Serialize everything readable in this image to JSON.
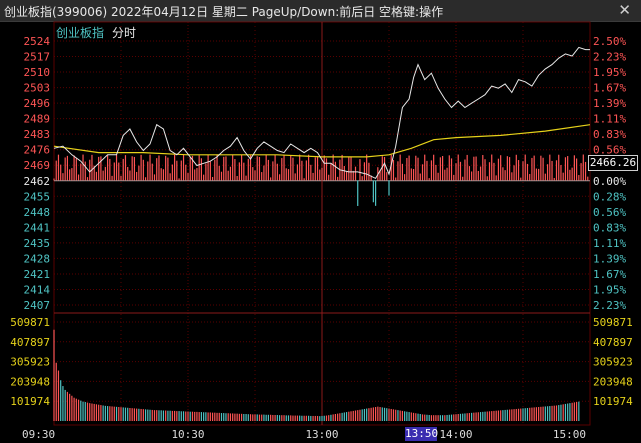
{
  "window": {
    "title": "创业板指(399006) 2022年04月12日 星期二 PageUp/Down:前后日 空格键:操作",
    "close_label": "✕"
  },
  "header": {
    "index_name": "创业板指",
    "mode_label": "分时"
  },
  "colors": {
    "up": "#ff5555",
    "down": "#4fc3c3",
    "grid": "#5a0000",
    "price_line": "#e8e8e8",
    "avg_line": "#e6d21a",
    "volume_axis": "#e6d21a",
    "prevclose": "#cfcfcf"
  },
  "current_price_label": "2466.26",
  "highlight_time": "13:50",
  "chart_data": {
    "type": "line",
    "title": "",
    "prev_close": 2462,
    "price_ticks": [
      "2524",
      "2517",
      "2510",
      "2503",
      "2496",
      "2489",
      "2483",
      "2476",
      "2469",
      "2462",
      "2455",
      "2448",
      "2441",
      "2435",
      "2428",
      "2421",
      "2414",
      "2407"
    ],
    "pct_ticks": [
      "2.50%",
      "2.23%",
      "1.95%",
      "1.67%",
      "1.39%",
      "1.11%",
      "0.83%",
      "0.56%",
      "0.28%",
      "0.00%",
      "0.28%",
      "0.56%",
      "0.83%",
      "1.11%",
      "1.39%",
      "1.67%",
      "1.95%",
      "2.23%"
    ],
    "volume_ticks": [
      "509871",
      "407897",
      "305923",
      "203948",
      "101974"
    ],
    "time_ticks": [
      "09:30",
      "10:30",
      "13:00",
      "14:00",
      "15:00"
    ],
    "ylim": [
      2404,
      2527
    ],
    "volume_max": 509871,
    "price_series": {
      "name": "",
      "points": [
        [
          0,
          2477
        ],
        [
          4,
          2478
        ],
        [
          8,
          2474
        ],
        [
          12,
          2471
        ],
        [
          16,
          2466
        ],
        [
          20,
          2470
        ],
        [
          24,
          2474
        ],
        [
          28,
          2474
        ],
        [
          31,
          2483
        ],
        [
          34,
          2486
        ],
        [
          37,
          2480
        ],
        [
          40,
          2476
        ],
        [
          43,
          2479
        ],
        [
          46,
          2488
        ],
        [
          49,
          2486
        ],
        [
          52,
          2476
        ],
        [
          55,
          2474
        ],
        [
          58,
          2477
        ],
        [
          61,
          2473
        ],
        [
          64,
          2469
        ],
        [
          67,
          2470
        ],
        [
          70,
          2471
        ],
        [
          73,
          2473
        ],
        [
          76,
          2476
        ],
        [
          79,
          2478
        ],
        [
          82,
          2482
        ],
        [
          85,
          2476
        ],
        [
          88,
          2472
        ],
        [
          91,
          2477
        ],
        [
          94,
          2480
        ],
        [
          97,
          2478
        ],
        [
          100,
          2476
        ],
        [
          103,
          2475
        ],
        [
          106,
          2479
        ],
        [
          109,
          2477
        ],
        [
          112,
          2475
        ],
        [
          115,
          2477
        ],
        [
          118,
          2475
        ],
        [
          121,
          2470
        ],
        [
          124,
          2470
        ],
        [
          128,
          2467
        ],
        [
          132,
          2466
        ],
        [
          136,
          2466
        ],
        [
          140,
          2465
        ],
        [
          144,
          2463
        ],
        [
          148,
          2470
        ],
        [
          150,
          2465
        ],
        [
          153,
          2478
        ],
        [
          156,
          2496
        ],
        [
          159,
          2500
        ],
        [
          161,
          2510
        ],
        [
          163,
          2516
        ],
        [
          166,
          2509
        ],
        [
          169,
          2512
        ],
        [
          172,
          2505
        ],
        [
          175,
          2500
        ],
        [
          178,
          2496
        ],
        [
          181,
          2499
        ],
        [
          184,
          2496
        ],
        [
          187,
          2498
        ],
        [
          190,
          2500
        ],
        [
          193,
          2502
        ],
        [
          196,
          2506
        ],
        [
          199,
          2505
        ],
        [
          202,
          2507
        ],
        [
          205,
          2503
        ],
        [
          208,
          2509
        ],
        [
          211,
          2508
        ],
        [
          214,
          2506
        ],
        [
          217,
          2511
        ],
        [
          220,
          2514
        ],
        [
          223,
          2516
        ],
        [
          226,
          2519
        ],
        [
          229,
          2521
        ],
        [
          232,
          2520
        ],
        [
          235,
          2524
        ],
        [
          238,
          2523
        ],
        [
          240,
          2523
        ]
      ]
    },
    "avg_series": {
      "name": "",
      "points": [
        [
          0,
          2478
        ],
        [
          20,
          2475
        ],
        [
          40,
          2475
        ],
        [
          60,
          2474
        ],
        [
          80,
          2474
        ],
        [
          100,
          2474
        ],
        [
          120,
          2473
        ],
        [
          140,
          2473
        ],
        [
          150,
          2474
        ],
        [
          160,
          2477
        ],
        [
          170,
          2481
        ],
        [
          180,
          2482
        ],
        [
          200,
          2483
        ],
        [
          220,
          2485
        ],
        [
          240,
          2488
        ]
      ]
    },
    "bars": {
      "count": 240,
      "amplitude_up": 4.5,
      "amplitude_down": 4.5
    },
    "volume": {
      "values": [
        470000,
        300000,
        260000,
        210000,
        180000,
        160000,
        150000,
        140000,
        130000,
        120000,
        115000,
        110000,
        105000,
        100000,
        98000,
        95000,
        92000,
        90000,
        88000,
        86000,
        84000,
        82000,
        80000,
        78000,
        77000,
        76000,
        75000,
        74000,
        73000,
        72000,
        71000,
        70000,
        69000,
        68000,
        67000,
        66000,
        65000,
        64000,
        63000,
        62000,
        61000,
        60000,
        59000,
        58000,
        57000,
        56000,
        56000,
        55000,
        55000,
        54000,
        54000,
        53000,
        53000,
        52000,
        52000,
        51000,
        51000,
        50000,
        50000,
        49000,
        49000,
        48000,
        48000,
        47000,
        47000,
        46000,
        46000,
        45000,
        45000,
        44000,
        44000,
        43000,
        43000,
        42000,
        42000,
        41000,
        41000,
        40000,
        40000,
        39000,
        39000,
        38000,
        38000,
        37000,
        37000,
        36000,
        36000,
        35000,
        35000,
        34000,
        34000,
        34000,
        33000,
        33000,
        33000,
        32000,
        32000,
        32000,
        31000,
        31000,
        31000,
        30000,
        30000,
        30000,
        29000,
        29000,
        29000,
        28000,
        28000,
        28000,
        28000,
        27000,
        27000,
        27000,
        27000,
        26000,
        26000,
        26000,
        26000,
        25000,
        26000,
        27000,
        28000,
        30000,
        32000,
        34000,
        36000,
        38000,
        40000,
        42000,
        44000,
        46000,
        48000,
        50000,
        52000,
        54000,
        56000,
        58000,
        60000,
        62000,
        64000,
        66000,
        68000,
        70000,
        72000,
        74000,
        72000,
        70000,
        68000,
        66000,
        64000,
        62000,
        60000,
        58000,
        56000,
        54000,
        52000,
        50000,
        48000,
        46000,
        44000,
        42000,
        40000,
        38000,
        36000,
        34000,
        33000,
        32000,
        31000,
        30000,
        30000,
        30000,
        30000,
        30000,
        30000,
        30000,
        31000,
        32000,
        33000,
        34000,
        35000,
        36000,
        37000,
        38000,
        39000,
        40000,
        41000,
        42000,
        43000,
        44000,
        45000,
        46000,
        47000,
        48000,
        49000,
        50000,
        51000,
        52000,
        53000,
        54000,
        55000,
        56000,
        57000,
        58000,
        59000,
        60000,
        61000,
        62000,
        63000,
        64000,
        65000,
        66000,
        67000,
        68000,
        69000,
        70000,
        71000,
        72000,
        73000,
        74000,
        75000,
        76000,
        77000,
        78000,
        79000,
        80000,
        82000,
        84000,
        86000,
        88000,
        90000,
        92000,
        94000,
        96000,
        98000,
        100000
      ]
    }
  }
}
